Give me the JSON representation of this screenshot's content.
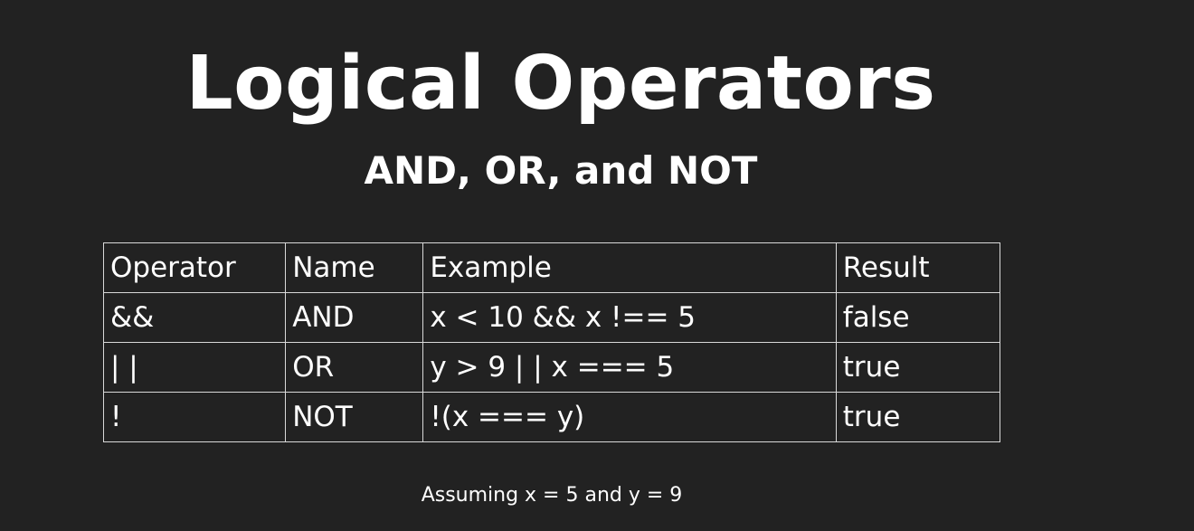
{
  "slide": {
    "title": "Logical Operators",
    "subtitle": "AND, OR, and NOT",
    "caption": "Assuming x = 5 and y = 9"
  },
  "table": {
    "headers": {
      "operator": "Operator",
      "name": "Name",
      "example": "Example",
      "result": "Result"
    },
    "rows": [
      {
        "operator": "&&",
        "name": "AND",
        "example": "x < 10 && x !== 5",
        "result": "false"
      },
      {
        "operator": "| |",
        "name": "OR",
        "example": "y > 9 | | x === 5",
        "result": "true"
      },
      {
        "operator": "!",
        "name": "NOT",
        "example": "!(x === y)",
        "result": "true"
      }
    ]
  },
  "colors": {
    "background": "#222222",
    "text": "#ffffff",
    "table_border": "#d9d9d9"
  }
}
